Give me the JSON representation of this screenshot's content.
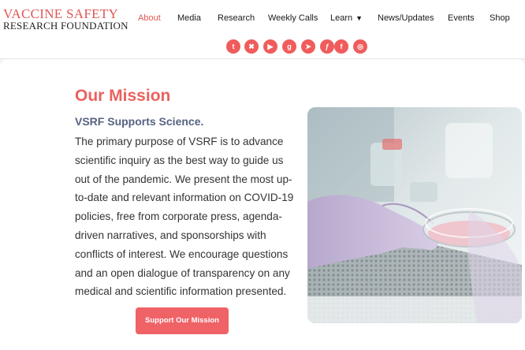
{
  "logo": {
    "line1": "VACCINE SAFETY",
    "line2": "RESEARCH FOUNDATION"
  },
  "nav": {
    "about": "About",
    "media": "Media",
    "research": "Research",
    "weekly_calls": "Weekly Calls",
    "learn": "Learn",
    "news": "News/Updates",
    "events": "Events",
    "shop": "Shop"
  },
  "socials": [
    {
      "name": "twitter-icon",
      "glyph": "t"
    },
    {
      "name": "gettr-icon",
      "glyph": "✖"
    },
    {
      "name": "rumble-icon",
      "glyph": "▶"
    },
    {
      "name": "gab-icon",
      "glyph": "g"
    },
    {
      "name": "telegram-icon",
      "glyph": "➤"
    },
    {
      "name": "truth-social-icon",
      "glyph": "ƒ"
    },
    {
      "name": "facebook-icon",
      "glyph": "f"
    },
    {
      "name": "instagram-icon",
      "glyph": "◎"
    }
  ],
  "mission": {
    "title": "Our Mission",
    "subtitle": "VSRF Supports Science.",
    "body": "The primary purpose of VSRF is to advance scientific inquiry as the best way to guide us out of the pandemic. We present the most up-to-date and relevant information on COVID-19 policies, free from corporate press, agenda-driven narratives, and sponsorships with conflicts of interest. We encourage questions and an open dialogue of transparency on any medical and scientific information presented.",
    "cta": "Support Our Mission"
  },
  "colors": {
    "accent": "#e8635f",
    "subtitle": "#566280",
    "social": "#f05c5c"
  }
}
